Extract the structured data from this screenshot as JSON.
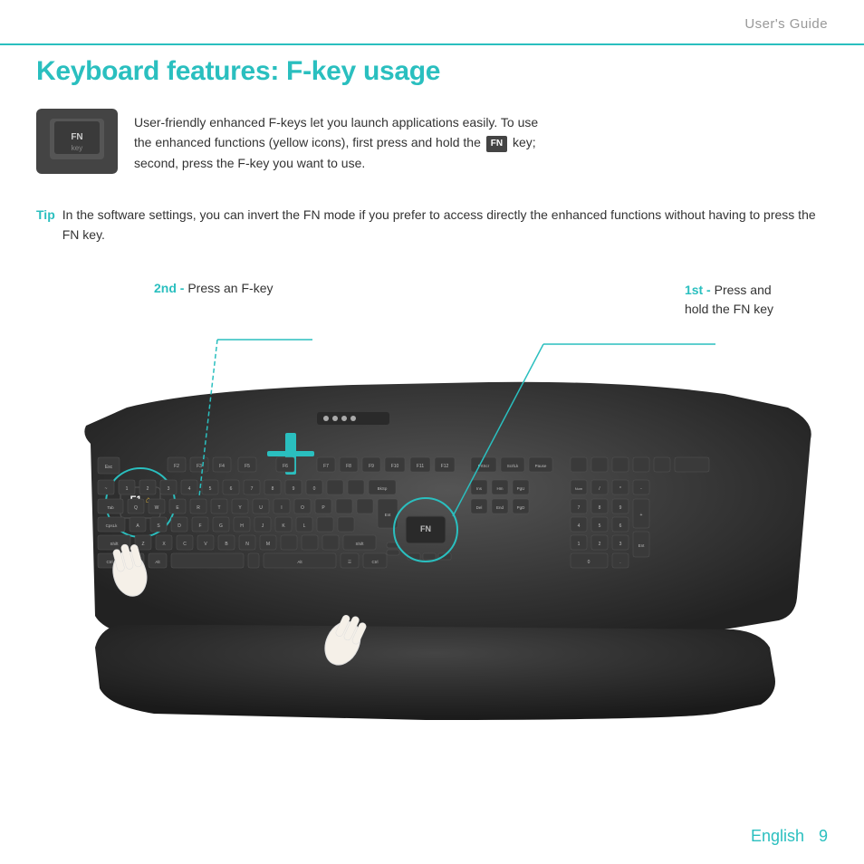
{
  "header": {
    "title": "User's Guide",
    "rule_color": "#2abfbf"
  },
  "page": {
    "title": "Keyboard features: F-key usage",
    "number": "9"
  },
  "intro": {
    "text_part1": "User-friendly enhanced F-keys let you launch applications easily. To use",
    "text_part2": "the enhanced functions (yellow icons), first press and hold the",
    "fn_badge": "FN",
    "text_part3": "key;",
    "text_part4": "second, press the F-key you want to use."
  },
  "tip": {
    "label": "Tip",
    "text": "In the software settings, you can invert the FN mode if you prefer to access directly the enhanced functions without having to press the FN key."
  },
  "callout_2nd": {
    "bold": "2nd -",
    "text": " Press an F-key"
  },
  "callout_1st": {
    "bold": "1st -",
    "text": " Press and\nhold the FN key"
  },
  "footer": {
    "language": "English",
    "page_number": "9"
  }
}
